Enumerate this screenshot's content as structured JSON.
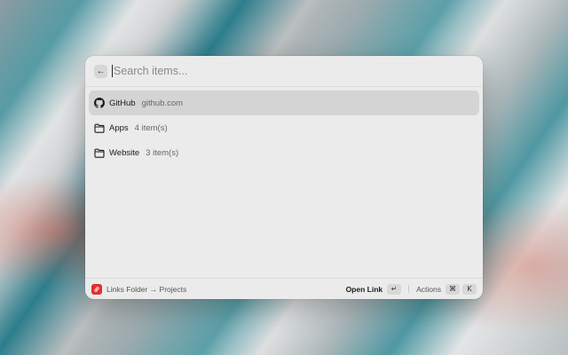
{
  "search": {
    "placeholder": "Search items...",
    "value": ""
  },
  "items": [
    {
      "title": "GitHub",
      "subtitle": "github.com",
      "icon": "github-icon",
      "selected": true
    },
    {
      "title": "Apps",
      "subtitle": "4 item(s)",
      "icon": "folder-icon",
      "selected": false
    },
    {
      "title": "Website",
      "subtitle": "3 item(s)",
      "icon": "folder-icon",
      "selected": false
    }
  ],
  "footer": {
    "extension_icon": "link-icon",
    "breadcrumb": "Links Folder → Projects",
    "primary_action": "Open Link",
    "primary_shortcut": "↵",
    "actions_label": "Actions",
    "actions_shortcut_1": "⌘",
    "actions_shortcut_2": "K"
  },
  "colors": {
    "extension_icon_bg": "#e0312b",
    "window_bg": "#ebebeb",
    "selected_row_bg": "#d4d4d4"
  }
}
